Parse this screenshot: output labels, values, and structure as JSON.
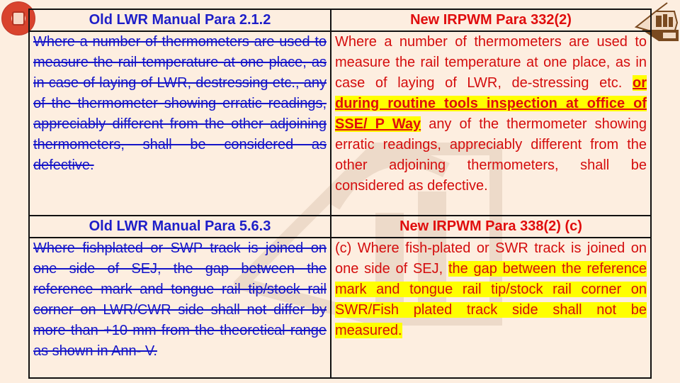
{
  "logos": {
    "left": "indian-railways-emblem",
    "right": "iricen-train-logo"
  },
  "sections": [
    {
      "old_heading": "Old LWR Manual Para 2.1.2",
      "new_heading": "New IRPWM Para 332(2)",
      "old_text": "Where a number of thermometers are used to measure the rail temperature at one place, as in case of laying of LWR, destressing etc., any of the thermometer showing erratic readings, appreciably different from the other adjoining thermometers, shall be considered as defective.",
      "new_text_before": "Where a number of thermometers are used to measure the rail temperature at one place, as in case of laying of LWR, de-stressing etc. ",
      "new_text_highlight": "or during routine tools inspection at office of SSE/ P Way",
      "new_text_after": " any of the thermometer showing erratic readings, appreciably different from the other adjoining thermometers, shall be considered as defective."
    },
    {
      "old_heading": "Old LWR Manual Para 5.6.3",
      "new_heading": "New IRPWM Para 338(2) (c)",
      "old_text": "Where fishplated or SWP track is joined on one side of SEJ, the gap between the reference mark and tongue rail tip/stock rail corner on LWR/CWR side shall not differ by more than +10 mm from the theoretical range as shown in Ann- V.",
      "new_text_before": "(c) Where fish-plated or SWR track is joined on one side of SEJ, ",
      "new_text_highlight": "the gap between the reference mark and tongue rail tip/stock rail corner on SWR/Fish plated track side shall not be measured.",
      "new_text_after": ""
    }
  ],
  "colors": {
    "background": "#fdeee0",
    "old_text": "#1414c8",
    "new_text": "#d40d0d",
    "highlight": "#ffff00"
  }
}
